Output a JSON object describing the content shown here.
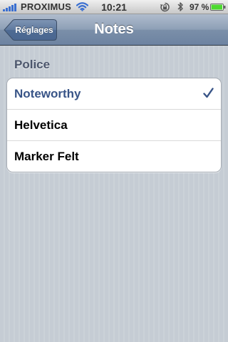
{
  "status_bar": {
    "carrier": "PROXIMUS",
    "time": "10:21",
    "battery_percent": "97 %",
    "battery_level": 0.97,
    "signal_bars": 5,
    "icons": [
      "signal-icon",
      "wifi-icon",
      "rotation-lock-icon",
      "bluetooth-icon",
      "battery-icon"
    ]
  },
  "nav": {
    "back_label": "Réglages",
    "title": "Notes"
  },
  "section": {
    "header": "Police"
  },
  "fonts": {
    "items": [
      {
        "label": "Noteworthy",
        "selected": true
      },
      {
        "label": "Helvetica",
        "selected": false
      },
      {
        "label": "Marker Felt",
        "selected": false
      }
    ]
  },
  "colors": {
    "selected_text": "#385487",
    "checkmark": "#385487",
    "nav_bar": "#8d9fb6",
    "background": "#c5ccd4"
  }
}
